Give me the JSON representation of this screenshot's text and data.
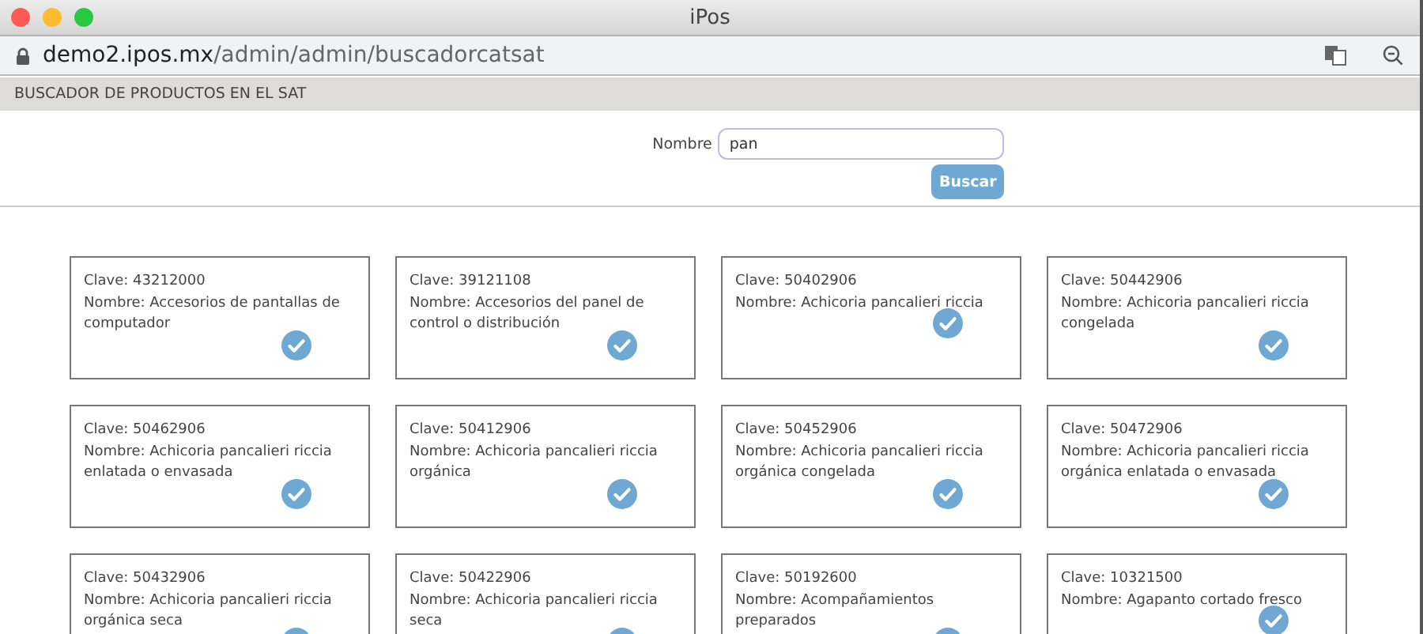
{
  "window": {
    "title": "iPos"
  },
  "address_bar": {
    "host": "demo2.ipos.mx",
    "path": "/admin/admin/buscadorcatsat"
  },
  "page_header": "BUSCADOR DE PRODUCTOS EN EL SAT",
  "search": {
    "label": "Nombre",
    "value": "pan",
    "button": "Buscar"
  },
  "results": [
    {
      "clave": "Clave: 43212000",
      "nombre": "Nombre: Accesorios de pantallas de computador"
    },
    {
      "clave": "Clave: 39121108",
      "nombre": "Nombre: Accesorios del panel de control o distribución"
    },
    {
      "clave": "Clave: 50402906",
      "nombre": "Nombre: Achicoria pancalieri riccia"
    },
    {
      "clave": "Clave: 50442906",
      "nombre": "Nombre: Achicoria pancalieri riccia congelada"
    },
    {
      "clave": "Clave: 50462906",
      "nombre": "Nombre: Achicoria pancalieri riccia enlatada o envasada"
    },
    {
      "clave": "Clave: 50412906",
      "nombre": "Nombre: Achicoria pancalieri riccia orgánica"
    },
    {
      "clave": "Clave: 50452906",
      "nombre": "Nombre: Achicoria pancalieri riccia orgánica congelada"
    },
    {
      "clave": "Clave: 50472906",
      "nombre": "Nombre: Achicoria pancalieri riccia orgánica enlatada o envasada"
    },
    {
      "clave": "Clave: 50432906",
      "nombre": "Nombre: Achicoria pancalieri riccia orgánica seca"
    },
    {
      "clave": "Clave: 50422906",
      "nombre": "Nombre: Achicoria pancalieri riccia seca"
    },
    {
      "clave": "Clave: 50192600",
      "nombre": "Nombre: Acompañamientos preparados"
    },
    {
      "clave": "Clave: 10321500",
      "nombre": "Nombre: Agapanto cortado fresco"
    }
  ]
}
